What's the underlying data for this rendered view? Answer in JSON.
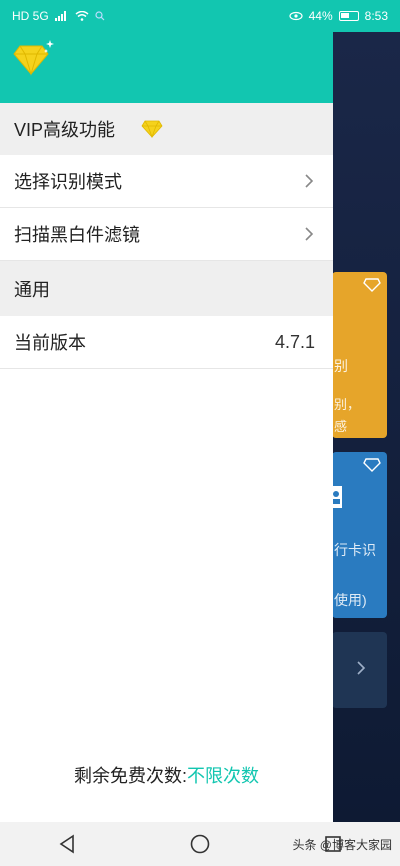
{
  "statusbar": {
    "left": "HD 5G",
    "battery_percent": "44%",
    "time": "8:53"
  },
  "drawer": {
    "vip_section": "VIP高级功能",
    "items": [
      {
        "label": "选择识别模式"
      },
      {
        "label": "扫描黑白件滤镜"
      }
    ],
    "general_section": "通用",
    "version_label": "当前版本",
    "version_value": "4.7.1",
    "footer_prefix": "剩余免费次数:",
    "footer_value": "不限次数"
  },
  "background": {
    "yellow_card_line1": "别",
    "yellow_card_line2": "别，",
    "yellow_card_line3": "感",
    "blue_card_line1": "行卡识",
    "blue_card_line2": "使用)"
  },
  "watermark": "头条 @博客大家园",
  "colors": {
    "accent": "#12c6b0",
    "diamond": "#f5d21c",
    "yellow_card": "#e6a52a",
    "blue_card": "#2a7bc0"
  }
}
